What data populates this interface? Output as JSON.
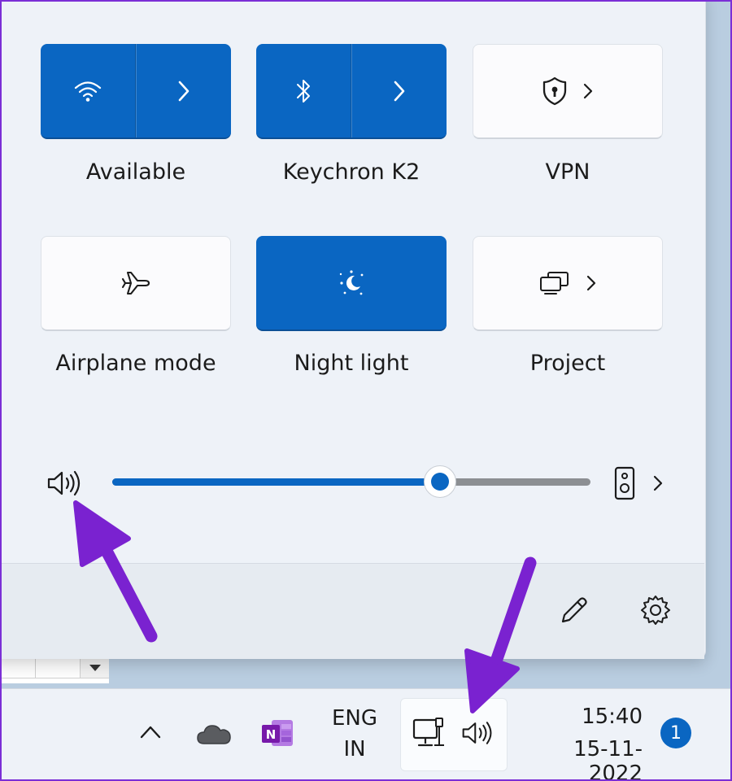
{
  "quick_settings": {
    "tiles": [
      {
        "id": "wifi",
        "label": "Available",
        "state": "on",
        "icon": "wifi-icon",
        "expand_icon": "chevron-right-icon"
      },
      {
        "id": "bluetooth",
        "label": "Keychron K2",
        "state": "on",
        "icon": "bluetooth-icon",
        "expand_icon": "chevron-right-icon"
      },
      {
        "id": "vpn",
        "label": "VPN",
        "state": "off",
        "icon": "shield-icon",
        "expand_icon": "chevron-right-icon"
      },
      {
        "id": "airplane",
        "label": "Airplane mode",
        "state": "off",
        "icon": "airplane-icon"
      },
      {
        "id": "night_light",
        "label": "Night light",
        "state": "on",
        "icon": "night-light-icon"
      },
      {
        "id": "project",
        "label": "Project",
        "state": "off",
        "icon": "project-icon",
        "expand_icon": "chevron-right-icon"
      }
    ],
    "volume": {
      "level_fraction": 0.685,
      "icon": "speaker-icon",
      "output_device_icon": "speaker-device-icon"
    },
    "footer": {
      "edit_icon": "pencil-icon",
      "settings_icon": "gear-icon"
    }
  },
  "taskbar": {
    "language_line1": "ENG",
    "language_line2": "IN",
    "time": "15:40",
    "date": "15-11-2022",
    "notification_count": "1",
    "icons": [
      "chevron-up-icon",
      "onedrive-cloud-icon",
      "onenote-icon",
      "network-icon",
      "speaker-icon"
    ]
  },
  "colors": {
    "accent": "#0a66c2",
    "annotation_arrow": "#7a22d0",
    "panel_bg": "#eef2f8"
  }
}
